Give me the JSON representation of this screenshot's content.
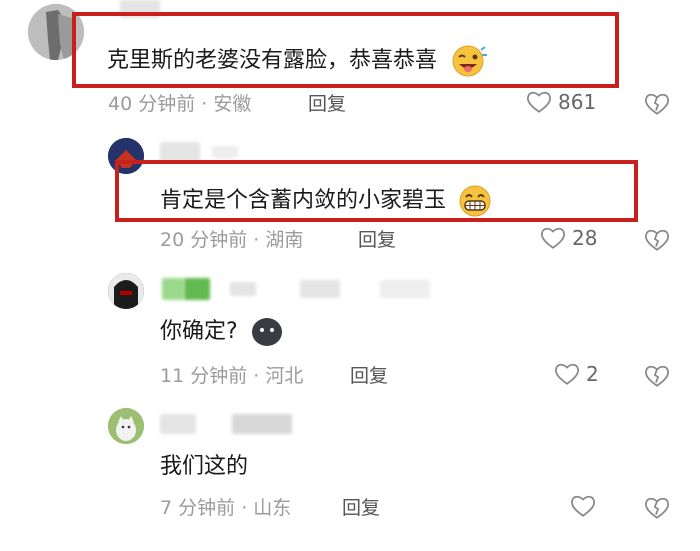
{
  "comments": [
    {
      "text": "克里斯的老婆没有露脸，恭喜恭喜",
      "time": "40 分钟前",
      "region": "安徽",
      "reply_label": "回复",
      "likes": "861",
      "emoji": "wink-tongue-emoji"
    },
    {
      "text": "肯定是个含蓄内敛的小家碧玉",
      "time": "20 分钟前",
      "region": "湖南",
      "reply_label": "回复",
      "likes": "28",
      "emoji": "grin-emoji"
    },
    {
      "text": "你确定?",
      "time": "11 分钟前",
      "region": "河北",
      "reply_label": "回复",
      "likes": "2",
      "emoji": "dark-blob-emoji"
    },
    {
      "text": "我们这的",
      "time": "7 分钟前",
      "region": "山东",
      "reply_label": "回复",
      "likes": ""
    }
  ],
  "separator": "·",
  "colors": {
    "highlight": "#c8201c",
    "meta": "#9b9b9b"
  }
}
